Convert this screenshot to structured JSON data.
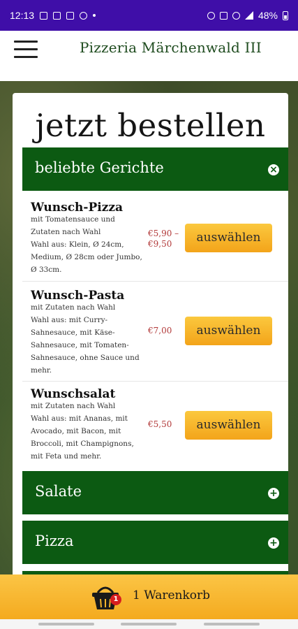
{
  "status_bar": {
    "time": "12:13",
    "battery": "48%"
  },
  "header": {
    "menu_icon": "hamburger-icon",
    "title": "Pizzeria Märchenwald III"
  },
  "main": {
    "title": "jetzt bestellen",
    "categories": [
      {
        "label": "beliebte Gerichte",
        "icon": "close-circle-icon",
        "expanded": true
      },
      {
        "label": "Salate",
        "icon": "plus-circle-icon",
        "expanded": false
      },
      {
        "label": "Pizza",
        "icon": "plus-circle-icon",
        "expanded": false
      }
    ],
    "items": [
      {
        "name": "Wunsch-Pizza",
        "desc1": "mit Tomatensauce und",
        "desc2": "Zutaten nach Wahl",
        "desc3": "Wahl aus: Klein, Ø 24cm,",
        "desc4": "Medium, Ø 28cm oder Jumbo,",
        "desc5": "Ø 33cm.",
        "price1": "€5,90 –",
        "price2": "€9,50",
        "button": "auswählen"
      },
      {
        "name": "Wunsch-Pasta",
        "desc1": "mit Zutaten nach Wahl",
        "desc2": "Wahl aus: mit Curry-",
        "desc3": "Sahnesauce, mit Käse-",
        "desc4": "Sahnesauce, mit Tomaten-",
        "desc5": "Sahnesauce, ohne Sauce und",
        "desc6": "mehr.",
        "price": "€7,00",
        "button": "auswählen"
      },
      {
        "name": "Wunschsalat",
        "desc1": "mit Zutaten nach Wahl",
        "desc2": "Wahl aus: mit Ananas, mit",
        "desc3": "Avocado, mit Bacon, mit",
        "desc4": "Broccoli, mit Champignons,",
        "desc5": "mit Feta und mehr.",
        "price": "€5,50",
        "button": "auswählen"
      }
    ]
  },
  "basket": {
    "count": "1",
    "label": "1 Warenkorb",
    "icon": "shopping-basket-icon"
  }
}
